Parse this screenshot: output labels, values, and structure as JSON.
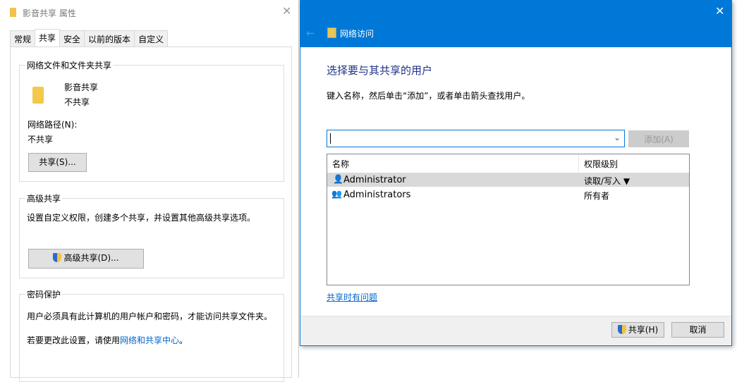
{
  "props": {
    "title": "影音共享 属性",
    "tabs": [
      "常规",
      "共享",
      "安全",
      "以前的版本",
      "自定义"
    ],
    "group1": {
      "label": "网络文件和文件夹共享",
      "folder_name": "影音共享",
      "folder_status": "不共享",
      "path_label": "网络路径(N):",
      "path_value": "不共享",
      "share_button": "共享(S)..."
    },
    "group2": {
      "label": "高级共享",
      "desc": "设置自定义权限，创建多个共享，并设置其他高级共享选项。",
      "button": "高级共享(D)..."
    },
    "group3": {
      "label": "密码保护",
      "desc": "用户必须具有此计算机的用户帐户和密码，才能访问共享文件夹。",
      "change_prefix": "若要更改此设置，请使用",
      "change_link": "网络和共享中心",
      "change_suffix": "。"
    }
  },
  "wizard": {
    "title": "网络访问",
    "heading": "选择要与其共享的用户",
    "instructions": "键入名称，然后单击“添加”，或者单击箭头查找用户。",
    "input_value": "",
    "add_button": "添加(A)",
    "columns": [
      "名称",
      "权限级别"
    ],
    "rows": [
      {
        "name": "Administrator",
        "permission": "读取/写入 ▼"
      },
      {
        "name": "Administrators",
        "permission": "所有者"
      }
    ],
    "help_link": "共享时有问题",
    "share_button": "共享(H)",
    "cancel_button": "取消"
  },
  "colors": {
    "accent": "#0078d7"
  }
}
